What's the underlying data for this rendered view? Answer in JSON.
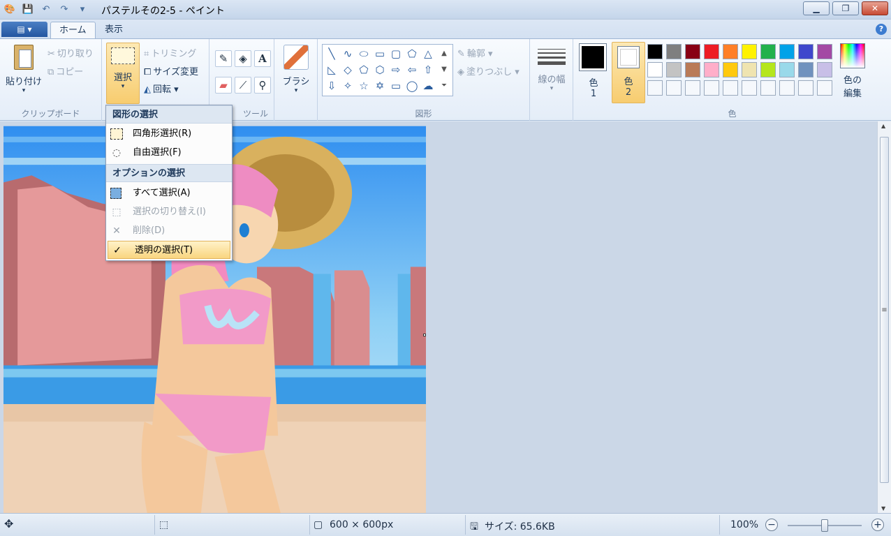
{
  "window": {
    "title": "パステルその2-5 - ペイント",
    "controls": {
      "minimize": "▁",
      "maximize": "❐",
      "close": "✕"
    }
  },
  "quick_access": {
    "icons": [
      "paint-app-icon",
      "save-icon",
      "undo-icon",
      "redo-icon",
      "customize-icon"
    ]
  },
  "tabs": {
    "file": "▤ ▾",
    "home": "ホーム",
    "view": "表示",
    "help": "?"
  },
  "ribbon": {
    "clipboard": {
      "paste": "貼り付け",
      "cut": "切り取り",
      "copy": "コピー",
      "label": "クリップボード"
    },
    "image": {
      "select": "選択",
      "crop": "トリミング",
      "resize": "サイズ変更",
      "rotate": "回転"
    },
    "tools": {
      "label": "ツール"
    },
    "brush": {
      "label": "ブラシ"
    },
    "shapes": {
      "label": "図形",
      "outline": "輪郭",
      "fill": "塗りつぶし"
    },
    "size": {
      "label": "線の幅"
    },
    "colors": {
      "label": "色",
      "color1": "色",
      "color1_num": "1",
      "color2": "色",
      "color2_num": "2",
      "edit": "色の",
      "edit2": "編集",
      "palette_row1": [
        "#000000",
        "#7f7f7f",
        "#880015",
        "#ed1c24",
        "#ff7f27",
        "#fff200",
        "#22b14c",
        "#00a2e8",
        "#3f48cc",
        "#a349a4"
      ],
      "palette_row2": [
        "#ffffff",
        "#c3c3c3",
        "#b97a57",
        "#ffaec9",
        "#ffc90e",
        "#efe4b0",
        "#b5e61d",
        "#99d9ea",
        "#7092be",
        "#c8bfe7"
      ]
    }
  },
  "select_menu": {
    "section1": "図形の選択",
    "rect_select": "四角形選択(R)",
    "free_select": "自由選択(F)",
    "section2": "オプションの選択",
    "select_all": "すべて選択(A)",
    "invert": "選択の切り替え(I)",
    "delete": "削除(D)",
    "transparent": "透明の選択(T)"
  },
  "status": {
    "dimensions": "600 × 600px",
    "size": "サイズ: 65.6KB",
    "zoom": "100%",
    "zoom_out": "−",
    "zoom_in": "+",
    "zoom_level": 0.5
  }
}
